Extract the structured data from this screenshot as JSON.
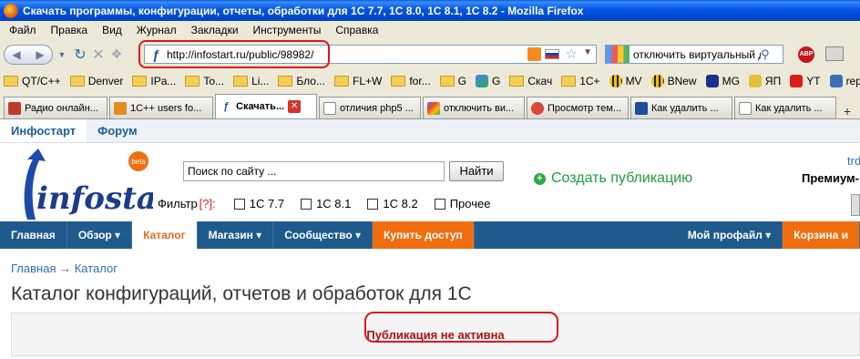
{
  "window": {
    "title": "Скачать программы, конфигурации, отчеты, обработки для 1С 7.7, 1С 8.0, 1С 8.1, 1С 8.2 - Mozilla Firefox"
  },
  "menu": [
    "Файл",
    "Правка",
    "Вид",
    "Журнал",
    "Закладки",
    "Инструменты",
    "Справка"
  ],
  "nav": {
    "url": "http://infostart.ru/public/98982/",
    "search_value": "отключить виртуальный д"
  },
  "bookmarks": [
    {
      "label": "QT/C++",
      "icon": "folder-icon"
    },
    {
      "label": "Denver",
      "icon": "folder-icon"
    },
    {
      "label": "IPa...",
      "icon": "folder-icon"
    },
    {
      "label": "To...",
      "icon": "folder-icon"
    },
    {
      "label": "Li...",
      "icon": "folder-icon"
    },
    {
      "label": "Бло...",
      "icon": "folder-icon"
    },
    {
      "label": "FL+W",
      "icon": "folder-icon"
    },
    {
      "label": "for...",
      "icon": "folder-icon"
    },
    {
      "label": "G",
      "icon": "folder-icon"
    },
    {
      "label": "G",
      "icon": "google-icon"
    },
    {
      "label": "Скач",
      "icon": "folder-icon"
    },
    {
      "label": "1С+",
      "icon": "folder-icon"
    },
    {
      "label": "MV",
      "icon": "bee-icon"
    },
    {
      "label": "BNew",
      "icon": "bee-icon"
    },
    {
      "label": "MG",
      "icon": "mg-icon"
    },
    {
      "label": "ЯП",
      "icon": "yandex-icon"
    },
    {
      "label": "YT",
      "icon": "youtube-icon"
    },
    {
      "label": "report",
      "icon": "report-icon"
    }
  ],
  "tabs": [
    {
      "label": "Радио онлайн...",
      "active": false
    },
    {
      "label": "1С++ users fo...",
      "active": false
    },
    {
      "label": "Скачать...",
      "active": true
    },
    {
      "label": "отличия php5 ...",
      "active": false
    },
    {
      "label": "отключить ви...",
      "active": false
    },
    {
      "label": "Просмотр тем...",
      "active": false
    },
    {
      "label": "Как удалить ...",
      "active": false
    },
    {
      "label": "Как удалить ...",
      "active": false
    }
  ],
  "site": {
    "top_tabs": [
      "Инфостарт",
      "Форум"
    ],
    "logo_text": "infostart",
    "logo_badge": "beta",
    "search_placeholder": "Поиск по сайту ...",
    "find_button": "Найти",
    "create_publication": "Создать публикацию",
    "user_name": "trdm",
    "user_status": "Премиум-",
    "filter_label": "Фильтр",
    "filter_help": "[?]:",
    "filter_options": [
      "1С 7.7",
      "1С 8.1",
      "1С 8.2",
      "Прочее"
    ],
    "main_nav": [
      "Главная",
      "Обзор ▾",
      "Каталог",
      "Магазин ▾",
      "Сообщество ▾",
      "Купить доступ"
    ],
    "main_nav_right": [
      "Мой профайл ▾",
      "Корзина и"
    ],
    "breadcrumb_home": "Главная",
    "breadcrumb_arrow": "→",
    "breadcrumb_current": "Каталог",
    "page_title": "Каталог конфигураций, отчетов и обработок для 1С",
    "notice": "Публикация не активна"
  },
  "colors": {
    "nav_bg": "#1f5a8c",
    "accent_orange": "#f06e10",
    "notice_red": "#b01010",
    "highlight_red": "#e0161b"
  }
}
